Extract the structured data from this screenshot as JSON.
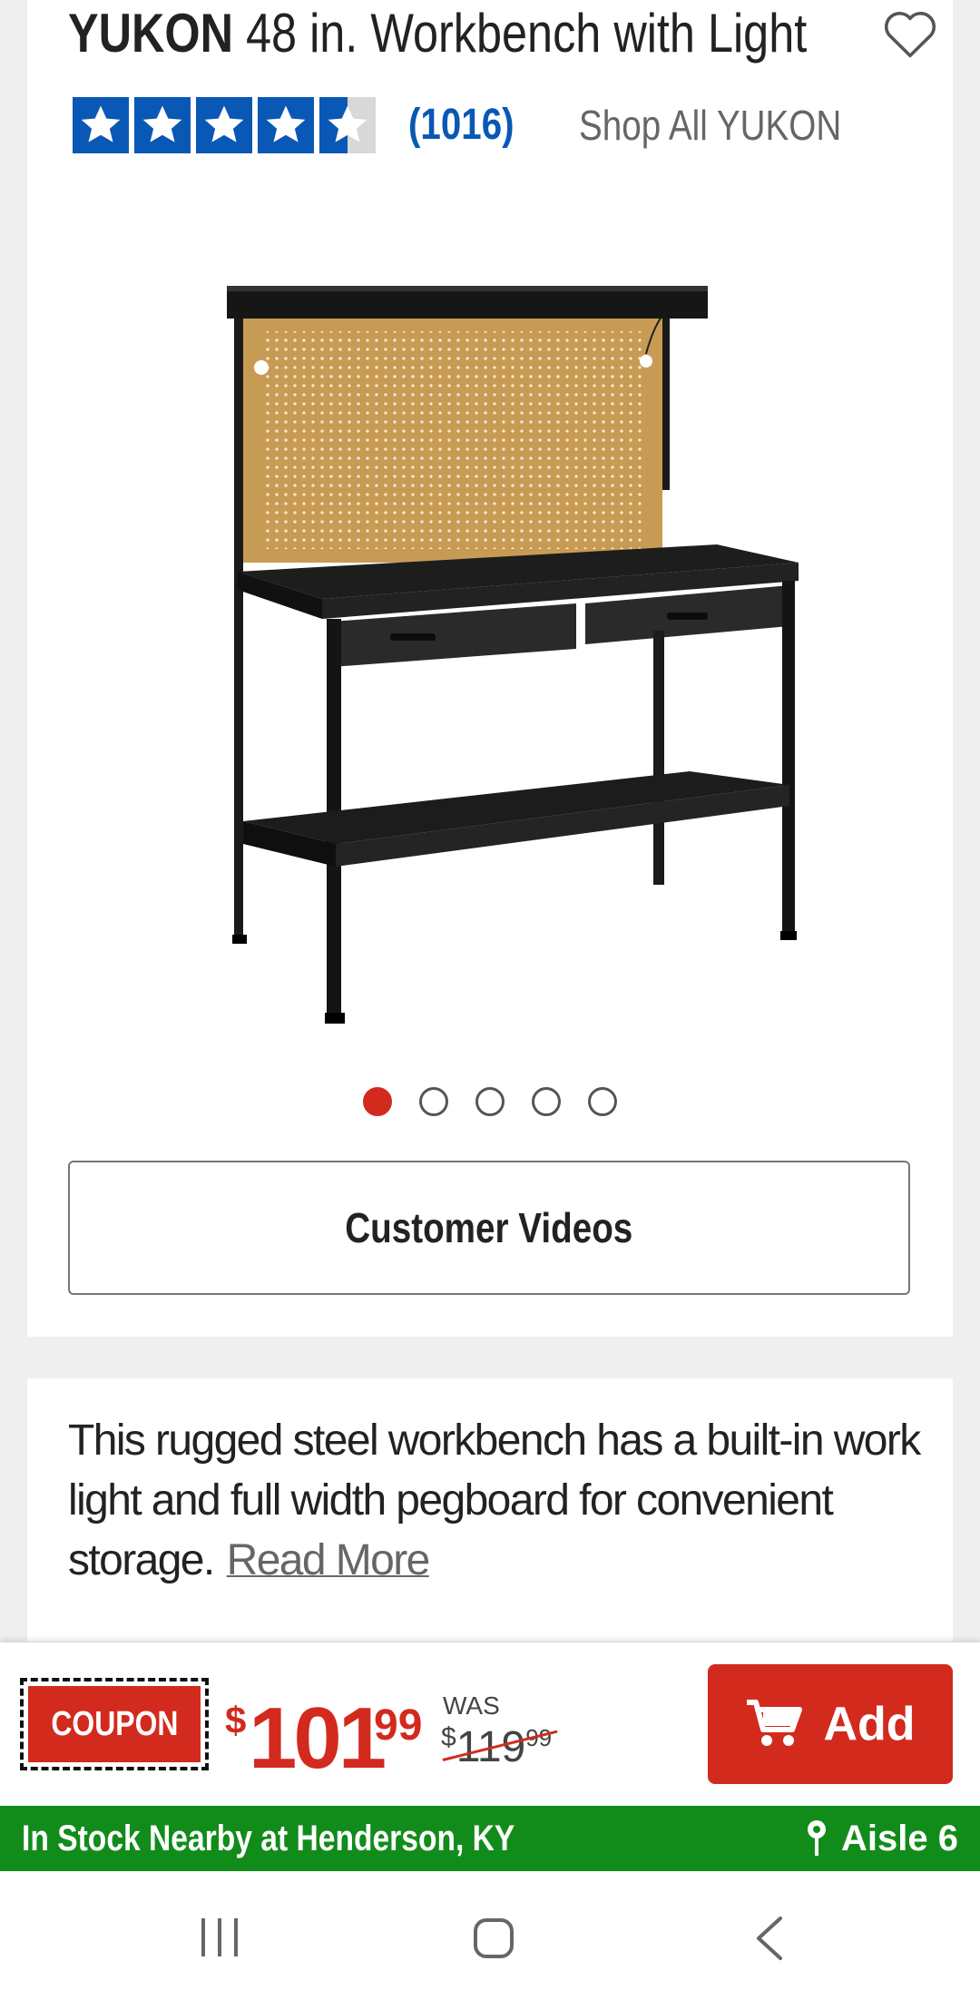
{
  "product": {
    "brand": "YUKON",
    "title": "48 in. Workbench with Light",
    "rating": 4.5,
    "review_count": "(1016)",
    "shop_all_link": "Shop All YUKON",
    "image_count": 5,
    "active_image_index": 0,
    "customer_videos_label": "Customer Videos"
  },
  "description": {
    "text": "This rugged steel workbench has a built-in work light and full width pegboard for convenient storage.",
    "read_more": "Read More"
  },
  "pricing": {
    "coupon_label": "COUPON",
    "currency_symbol": "$",
    "price_dollars": "101",
    "price_cents": "99",
    "was_label": "WAS",
    "was_dollars": "119",
    "was_cents": "99",
    "add_label": "Add"
  },
  "stock": {
    "text": "In Stock Nearby at Henderson, KY",
    "aisle": "Aisle 6"
  },
  "colors": {
    "brand_red": "#d32a1e",
    "rating_blue": "#0a58b5",
    "stock_green": "#118c1b"
  },
  "icons": [
    "heart-icon",
    "star-icon",
    "cart-icon",
    "location-pin-icon",
    "recent-apps-icon",
    "home-icon",
    "back-icon"
  ]
}
